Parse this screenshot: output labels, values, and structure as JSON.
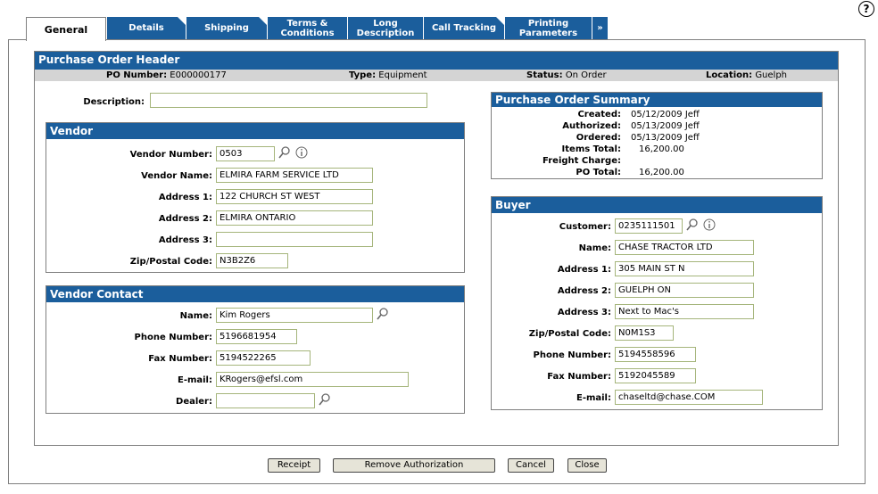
{
  "help_label": "?",
  "tabs": [
    {
      "label": "General"
    },
    {
      "label": "Details"
    },
    {
      "label": "Shipping"
    },
    {
      "label": "Terms & Conditions"
    },
    {
      "label": "Long Description"
    },
    {
      "label": "Call Tracking"
    },
    {
      "label": "Printing Parameters"
    },
    {
      "label": "»"
    }
  ],
  "header": {
    "title": "Purchase Order Header",
    "po_number_label": "PO Number:",
    "po_number": "E000000177",
    "type_label": "Type:",
    "type": "Equipment",
    "status_label": "Status:",
    "status": "On Order",
    "location_label": "Location:",
    "location": "Guelph"
  },
  "description": {
    "label": "Description:",
    "value": ""
  },
  "vendor": {
    "title": "Vendor",
    "number_label": "Vendor Number:",
    "number": "0503",
    "name_label": "Vendor Name:",
    "name": "ELMIRA FARM SERVICE LTD",
    "address1_label": "Address 1:",
    "address1": "122 CHURCH ST WEST",
    "address2_label": "Address 2:",
    "address2": "ELMIRA ONTARIO",
    "address3_label": "Address 3:",
    "address3": "",
    "zip_label": "Zip/Postal Code:",
    "zip": "N3B2Z6"
  },
  "vendor_contact": {
    "title": "Vendor Contact",
    "name_label": "Name:",
    "name": "Kim Rogers",
    "phone_label": "Phone Number:",
    "phone": "5196681954",
    "fax_label": "Fax Number:",
    "fax": "5194522265",
    "email_label": "E-mail:",
    "email": "KRogers@efsl.com",
    "dealer_label": "Dealer:",
    "dealer": ""
  },
  "summary": {
    "title": "Purchase Order Summary",
    "created_label": "Created:",
    "created": "05/12/2009 Jeff",
    "authorized_label": "Authorized:",
    "authorized": "05/13/2009 Jeff",
    "ordered_label": "Ordered:",
    "ordered": "05/13/2009 Jeff",
    "items_total_label": "Items Total:",
    "items_total": "16,200.00",
    "freight_label": "Freight Charge:",
    "freight": "",
    "po_total_label": "PO Total:",
    "po_total": "16,200.00"
  },
  "buyer": {
    "title": "Buyer",
    "customer_label": "Customer:",
    "customer": "0235111501",
    "name_label": "Name:",
    "name": "CHASE TRACTOR LTD",
    "address1_label": "Address 1:",
    "address1": "305 MAIN ST N",
    "address2_label": "Address 2:",
    "address2": "GUELPH ON",
    "address3_label": "Address 3:",
    "address3": "Next to Mac's",
    "zip_label": "Zip/Postal Code:",
    "zip": "N0M1S3",
    "phone_label": "Phone Number:",
    "phone": "5194558596",
    "fax_label": "Fax Number:",
    "fax": "5192045589",
    "email_label": "E-mail:",
    "email": "chaseltd@chase.COM"
  },
  "buttons": {
    "receipt": "Receipt",
    "remove_authorization": "Remove Authorization",
    "cancel": "Cancel",
    "close": "Close"
  },
  "colors": {
    "accent": "#1b5e9c",
    "info_bar": "#d4d4d4",
    "input_border": "#a5b57b"
  }
}
